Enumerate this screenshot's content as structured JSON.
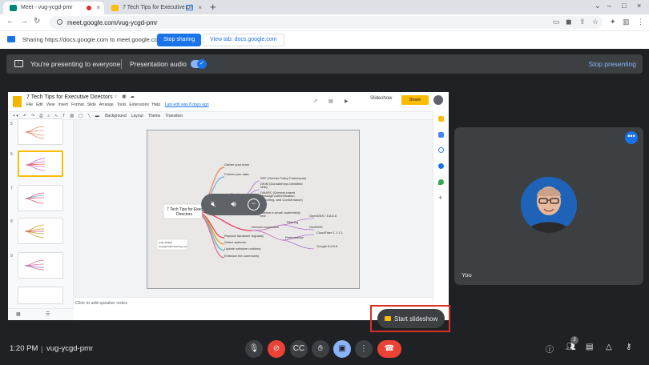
{
  "browser": {
    "tabs": [
      {
        "title": "Meet - vug-ycgd-pmr",
        "close": "×"
      },
      {
        "title": "7 Tech Tips for Executive Di",
        "close": "×"
      }
    ],
    "new_tab": "+",
    "url": "meet.google.com/vug-ycgd-pmr",
    "window_controls": [
      "⌄",
      "–",
      "□",
      "×"
    ]
  },
  "share_bar": {
    "message": "Sharing https://docs.google.com to meet.google.com",
    "stop_label": "Stop sharing",
    "view_label": "View tab: docs.google.com"
  },
  "presenting_banner": {
    "message": "You're presenting to everyone",
    "audio_label": "Presentation audio",
    "audio_on": true,
    "stop_label": "Stop presenting"
  },
  "slides_app": {
    "title": "7 Tech Tips for Executive Directors",
    "menu": [
      "File",
      "Edit",
      "View",
      "Insert",
      "Format",
      "Slide",
      "Arrange",
      "Tools",
      "Extensions",
      "Help"
    ],
    "last_edit": "Last edit was 8 days ago",
    "slideshow_label": "Slideshow",
    "share_label": "Share",
    "toolbar": [
      "Background",
      "Layout",
      "Theme",
      "Transition"
    ],
    "thumb_numbers": [
      "5",
      "6",
      "7",
      "8",
      "9"
    ],
    "notes_placeholder": "Click to add speaker notes",
    "slide": {
      "center_lines": [
        "7 Tech Tips for Executive",
        "Directors"
      ],
      "upper_branches": [
        "Gather your team",
        "Protect your data"
      ],
      "email_label": "Email",
      "email_items": [
        "SPF (Sender Policy Framework)",
        "DKIM (DomainKeys Identified",
        "Mail)",
        "DMARC (Domain-based",
        "Message Authentication,",
        "Reporting, and Conformance)",
        "Internal e-email 'authenticity",
        "test'"
      ],
      "internet_label": "Internet connection",
      "filtering_label": "Filtering",
      "filtering_items": [
        "OpenDNS / 8.8.8.8",
        "NextDNS"
      ],
      "performance_label": "Performance",
      "performance_items": [
        "CloudFlare 1.1.1.1",
        "Google 8.8.8.8"
      ],
      "lower_branches": [
        "Replace hardware regularly",
        "Select systems",
        "Update software routinely",
        "Embrace the community"
      ],
      "author_lines": [
        "Andy Phillips",
        "andy@craftofmeaning.com"
      ]
    }
  },
  "start_slideshow_label": "Start slideshow",
  "participant": {
    "name": "You",
    "more": "•••"
  },
  "bottom": {
    "time": "1:20 PM",
    "separator": "|",
    "meeting_code": "vug-ycgd-pmr",
    "people_count": "2"
  },
  "colors": {
    "accent": "#1a73e8",
    "end_call": "#ea4335",
    "highlight": "#d93025",
    "slides_yellow": "#fbbc04"
  }
}
